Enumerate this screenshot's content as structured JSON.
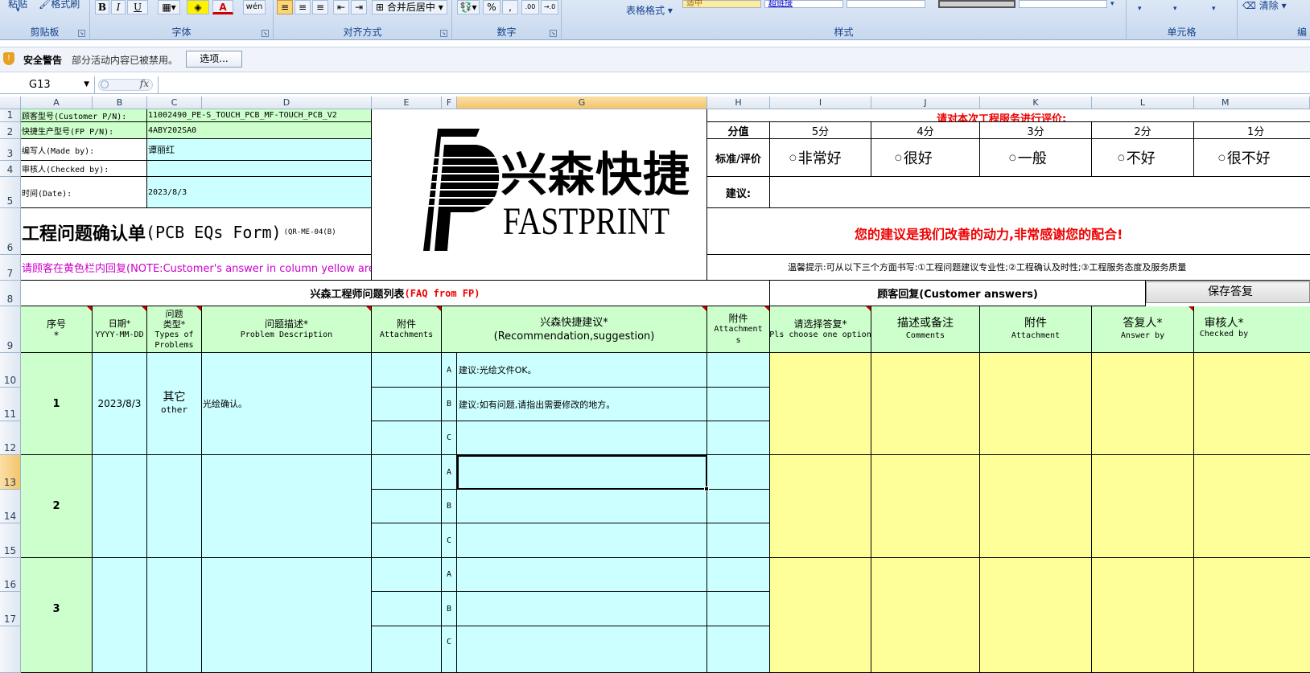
{
  "ribbon": {
    "groups": [
      {
        "label": "剪贴板"
      },
      {
        "label": "字体"
      },
      {
        "label": "对齐方式"
      },
      {
        "label": "数字"
      },
      {
        "label": "样式"
      },
      {
        "label": "单元格"
      },
      {
        "label": "编"
      }
    ],
    "paste_label": "粘贴",
    "format_painter": "格式刷",
    "wrap_merge": "合并后居中",
    "table_format": "表格格式",
    "clear_label": "清除",
    "font_buttons": {
      "bold": "B",
      "italic": "I",
      "underline": "U",
      "font_color": "A",
      "wen": "wén"
    },
    "number_buttons": {
      "percent": "%",
      "comma": ",",
      "inc_dec": ".00",
      "dec_dec": "→.0"
    },
    "style_normal": "适中",
    "style_link": "超链接"
  },
  "security": {
    "title": "安全警告",
    "message": "部分活动内容已被禁用。",
    "options_button": "选项..."
  },
  "formula_bar": {
    "name_box": "G13",
    "fx": "fx",
    "value": ""
  },
  "columns": [
    {
      "l": "A"
    },
    {
      "l": "B"
    },
    {
      "l": "C"
    },
    {
      "l": "D"
    },
    {
      "l": "E"
    },
    {
      "l": "F"
    },
    {
      "l": "G"
    },
    {
      "l": "H"
    },
    {
      "l": "I"
    },
    {
      "l": "J"
    },
    {
      "l": "K"
    },
    {
      "l": "L"
    },
    {
      "l": "M"
    }
  ],
  "rows": [
    "1",
    "2",
    "3",
    "4",
    "5",
    "6",
    "7",
    "8",
    "9",
    "10",
    "11",
    "12",
    "13",
    "14",
    "15",
    "16",
    "17"
  ],
  "info": {
    "customer_pn_label": "顾客型号(Customer P/N):",
    "customer_pn": "11002490_PE-S_TOUCH_PCB_MF-TOUCH_PCB_V2",
    "fp_pn_label": "快捷生产型号(FP P/N):",
    "fp_pn": "4ABY202SA0",
    "made_by_label": "编写人(Made by):",
    "made_by": "谭丽红",
    "checked_by_label": "审核人(Checked by):",
    "checked_by": "",
    "date_label": "时间(Date):",
    "date": "2023/8/3",
    "form_title": "工程问题确认单",
    "form_title_en": "(PCB EQs Form)",
    "form_code": "(QR-ME-04(B)",
    "note": "请顾客在黄色栏内回复(NOTE:Customer's answer in column yellow area)"
  },
  "logo": {
    "cn": "兴森快捷",
    "en": "FASTPRINT"
  },
  "rating": {
    "title": "请对本次工程服务进行评价:",
    "score_label": "分值",
    "criteria_label": "标准/评价",
    "suggestion_label": "建议:",
    "scores": [
      "5分",
      "4分",
      "3分",
      "2分",
      "1分"
    ],
    "options": [
      "非常好",
      "很好",
      "一般",
      "不好",
      "很不好"
    ],
    "thanks": "您的建议是我们改善的动力,非常感谢您的配合!",
    "tip": "温馨提示:可从以下三个方面书写:①工程问题建议专业性;②工程确认及时性;③工程服务态度及服务质量"
  },
  "faq": {
    "title": "兴森工程师问题列表",
    "title_en": "(FAQ from FP)",
    "customer_title": "顾客回复(Customer answers)",
    "save_button": "保存答复"
  },
  "headers": {
    "seq": [
      "序号",
      "*"
    ],
    "date": [
      "日期*",
      "YYYY-MM-DD"
    ],
    "type": [
      "问题",
      "类型*",
      "Types of",
      "Problems"
    ],
    "desc": [
      "问题描述*",
      "Problem Description"
    ],
    "attach": [
      "附件",
      "Attachments"
    ],
    "rec": [
      "兴森快捷建议*",
      "(Recommendation,suggestion)"
    ],
    "attach2": [
      "附件",
      "Attachment",
      "s"
    ],
    "choose": [
      "请选择答复*",
      "Pls choose one option"
    ],
    "comments": [
      "描述或备注",
      "Comments"
    ],
    "attachment": [
      "附件",
      "Attachment"
    ],
    "answer": [
      "答复人*",
      "Answer by"
    ],
    "checked": [
      "审核人*",
      "Checked by"
    ]
  },
  "issues": [
    {
      "no": "1",
      "date": "2023/8/3",
      "type_cn": "其它",
      "type_en": "other",
      "desc": "光绘确认。",
      "options": [
        {
          "letter": "A",
          "text": "建议:光绘文件OK。"
        },
        {
          "letter": "B",
          "text": "建议:如有问题,请指出需要修改的地方。"
        },
        {
          "letter": "C",
          "text": ""
        }
      ]
    },
    {
      "no": "2",
      "date": "",
      "type_cn": "",
      "type_en": "",
      "desc": "",
      "options": [
        {
          "letter": "A",
          "text": ""
        },
        {
          "letter": "B",
          "text": ""
        },
        {
          "letter": "C",
          "text": ""
        }
      ]
    },
    {
      "no": "3",
      "date": "",
      "type_cn": "",
      "type_en": "",
      "desc": "",
      "options": [
        {
          "letter": "A",
          "text": ""
        },
        {
          "letter": "B",
          "text": ""
        },
        {
          "letter": "C",
          "text": ""
        }
      ]
    }
  ],
  "colors": {
    "green": "#ccffcc",
    "cyan": "#ccffff",
    "yellow": "#ffff99",
    "red": "#ff0000",
    "magenta": "#cc00cc"
  }
}
